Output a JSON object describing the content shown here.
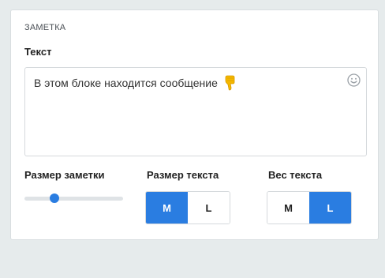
{
  "note": {
    "section_title": "ЗАМЕТКА",
    "text_label": "Текст",
    "message": "В этом блоке находится сообщение",
    "message_icon": "thumbs-down-icon",
    "emoji_button_icon": "smiley-icon"
  },
  "controls": {
    "note_size": {
      "label": "Размер заметки",
      "value_fraction": 0.28
    },
    "text_size": {
      "label": "Размер текста",
      "options": [
        "M",
        "L"
      ],
      "selected": "M"
    },
    "text_weight": {
      "label": "Вес текста",
      "options": [
        "M",
        "L"
      ],
      "selected": "L"
    }
  },
  "colors": {
    "accent": "#2a7de1",
    "background": "#e6ebec",
    "emoji_yellow": "#f5b800"
  }
}
